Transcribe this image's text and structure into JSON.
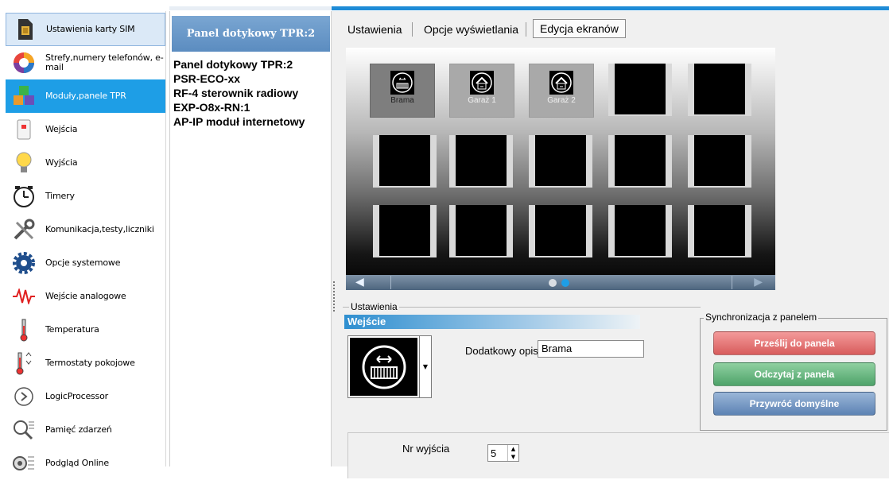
{
  "sidebar": {
    "items": [
      {
        "label": "Ustawienia karty SIM",
        "icon": "sim-card-icon"
      },
      {
        "label": "Strefy,numery telefonów, e-mail",
        "icon": "zones-pie-icon"
      },
      {
        "label": "Moduły,panele TPR",
        "icon": "modules-cubes-icon"
      },
      {
        "label": "Wejścia",
        "icon": "input-sensor-icon"
      },
      {
        "label": "Wyjścia",
        "icon": "output-bulb-icon"
      },
      {
        "label": "Timery",
        "icon": "clock-icon"
      },
      {
        "label": "Komunikacja,testy,liczniki",
        "icon": "tools-icon"
      },
      {
        "label": "Opcje systemowe",
        "icon": "gear-icon"
      },
      {
        "label": "Wejście analogowe",
        "icon": "analog-wave-icon"
      },
      {
        "label": "Temperatura",
        "icon": "thermometer-icon"
      },
      {
        "label": "Termostaty pokojowe",
        "icon": "thermostat-icon"
      },
      {
        "label": "LogicProcessor",
        "icon": "logic-processor-icon"
      },
      {
        "label": "Pamięć zdarzeń",
        "icon": "event-memory-icon"
      },
      {
        "label": "Podgląd Online",
        "icon": "online-preview-icon"
      }
    ]
  },
  "module_list": {
    "header": "Panel dotykowy TPR:2",
    "items": [
      "Panel dotykowy TPR:2",
      "PSR-ECO-xx",
      "RF-4 sterownik radiowy",
      "EXP-O8x-RN:1",
      "AP-IP moduł internetowy"
    ]
  },
  "tabs": [
    "Ustawienia",
    "Opcje wyświetlania",
    "Edycja  ekranów"
  ],
  "screen": {
    "tiles": [
      {
        "label": "Brama",
        "icon": "gate-icon"
      },
      {
        "label": "Garaż 1",
        "icon": "garage-icon"
      },
      {
        "label": "Garaż 2",
        "icon": "garage-icon"
      }
    ]
  },
  "settings": {
    "group_title": "Ustawienia",
    "type_label": "Wejście",
    "description_label": "Dodatkowy opis",
    "description_value": "Brama",
    "output_label": "Nr wyjścia",
    "output_value": "5"
  },
  "sync": {
    "title": "Synchronizacja z panelem",
    "send_label": "Prześlij do panela",
    "read_label": "Odczytaj z panela",
    "restore_label": "Przywróć domyślne"
  },
  "colors": {
    "accent": "#1e9ee6",
    "send": "#e57373",
    "read": "#66bb80",
    "restore": "#7093c4"
  }
}
